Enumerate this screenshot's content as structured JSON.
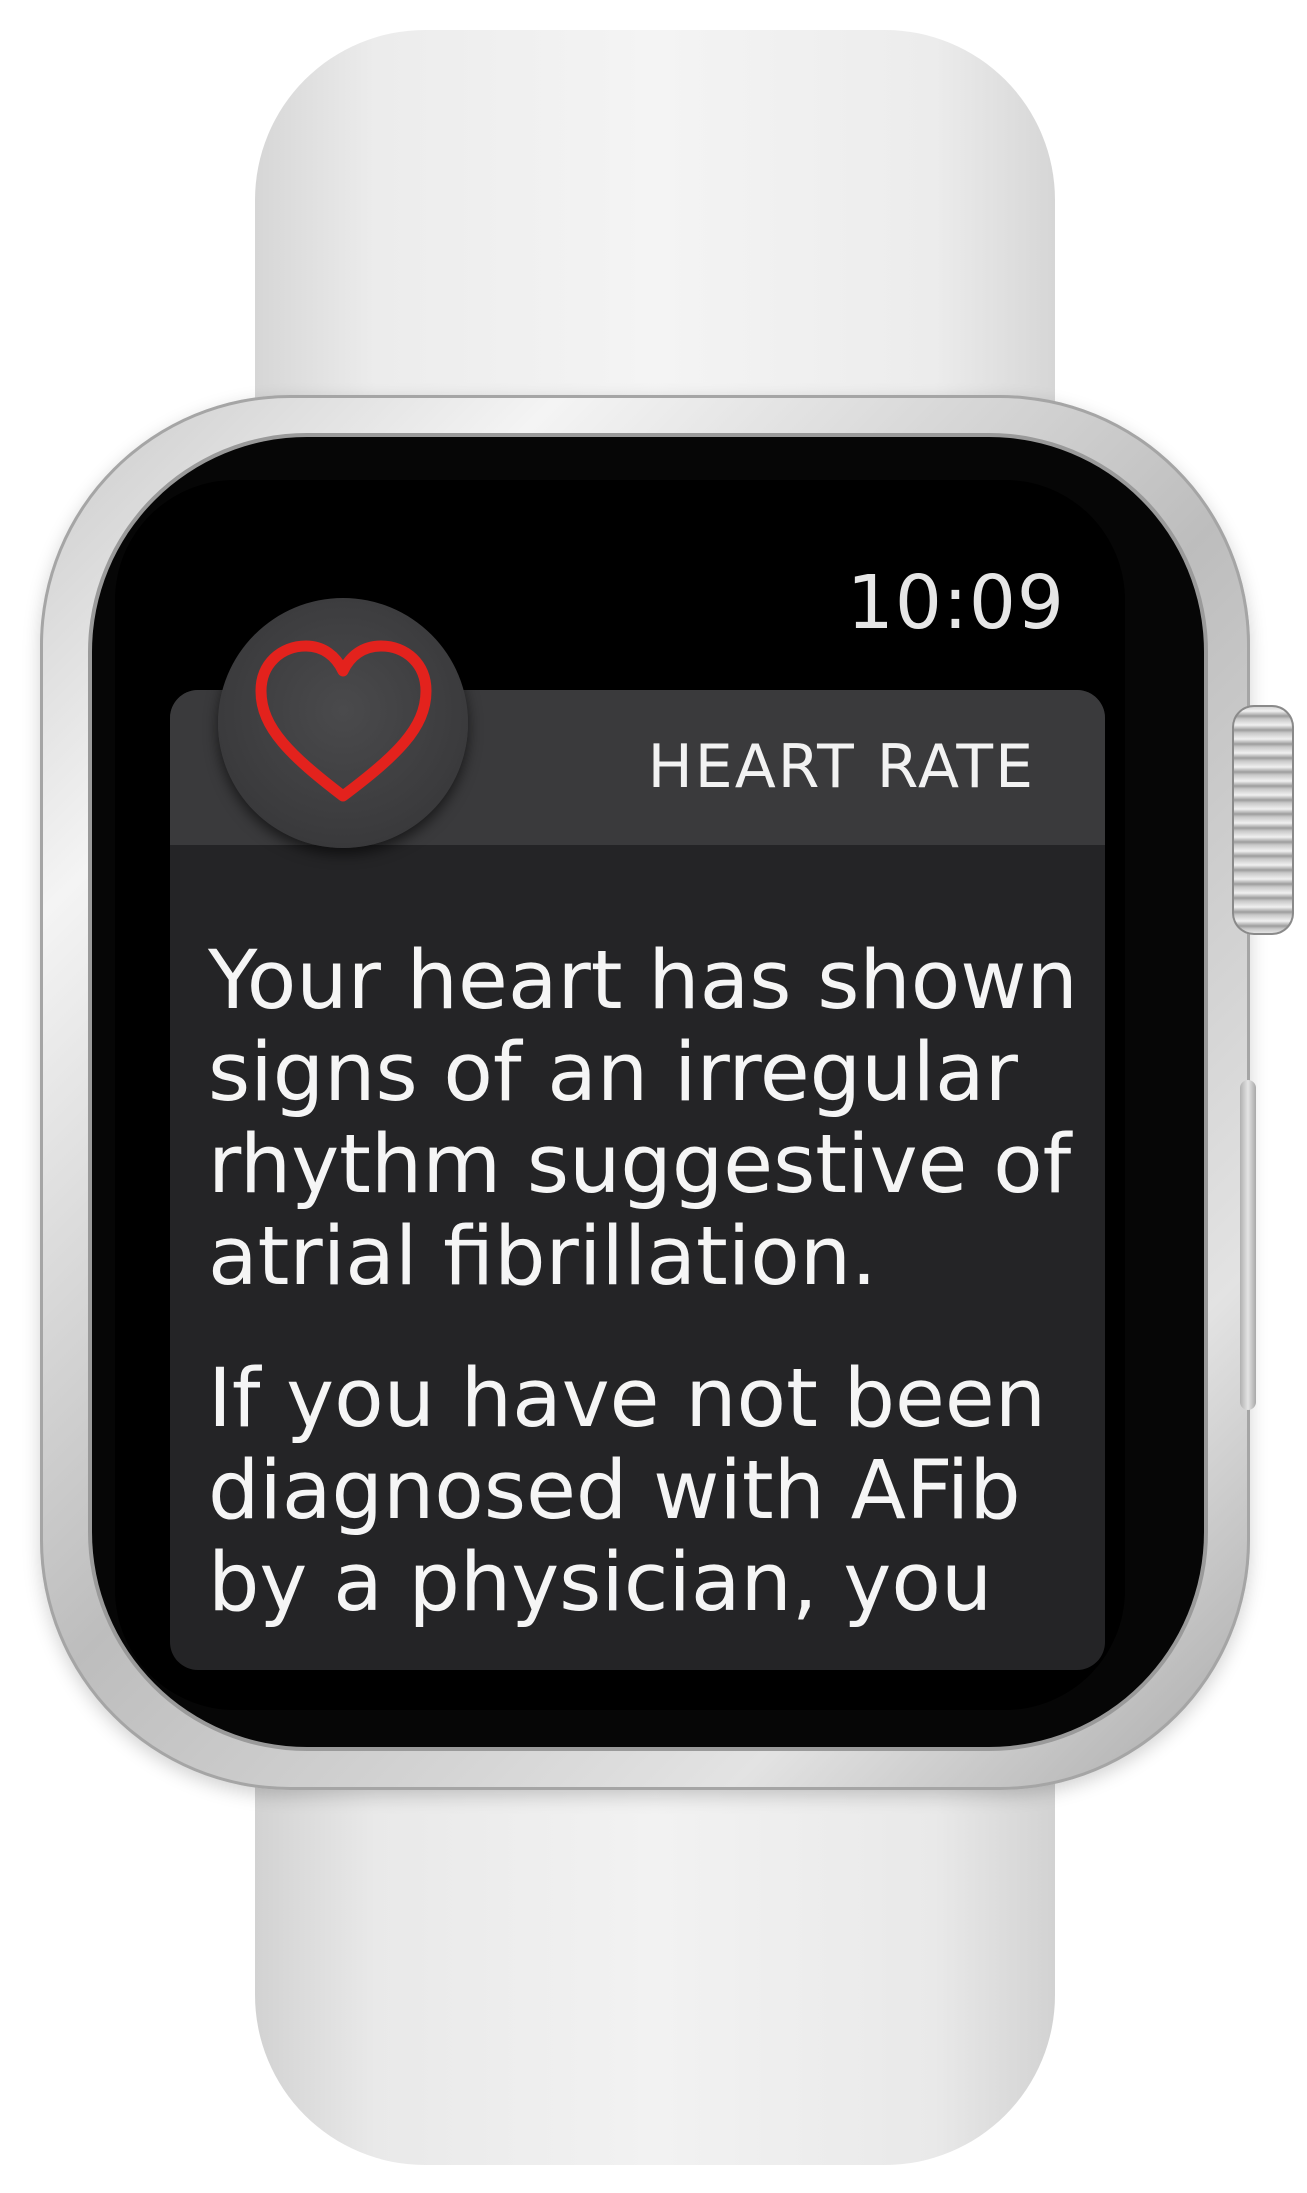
{
  "status_bar": {
    "time": "10:09"
  },
  "notification": {
    "app_name": "HEART RATE",
    "app_icon": "heart-icon",
    "accent_color": "#e3221d",
    "paragraphs": [
      "Your heart has shown signs of an irregular rhythm suggestive of atrial fibrillation.",
      "If you have not been diagnosed with AFib by a physician, you"
    ]
  }
}
